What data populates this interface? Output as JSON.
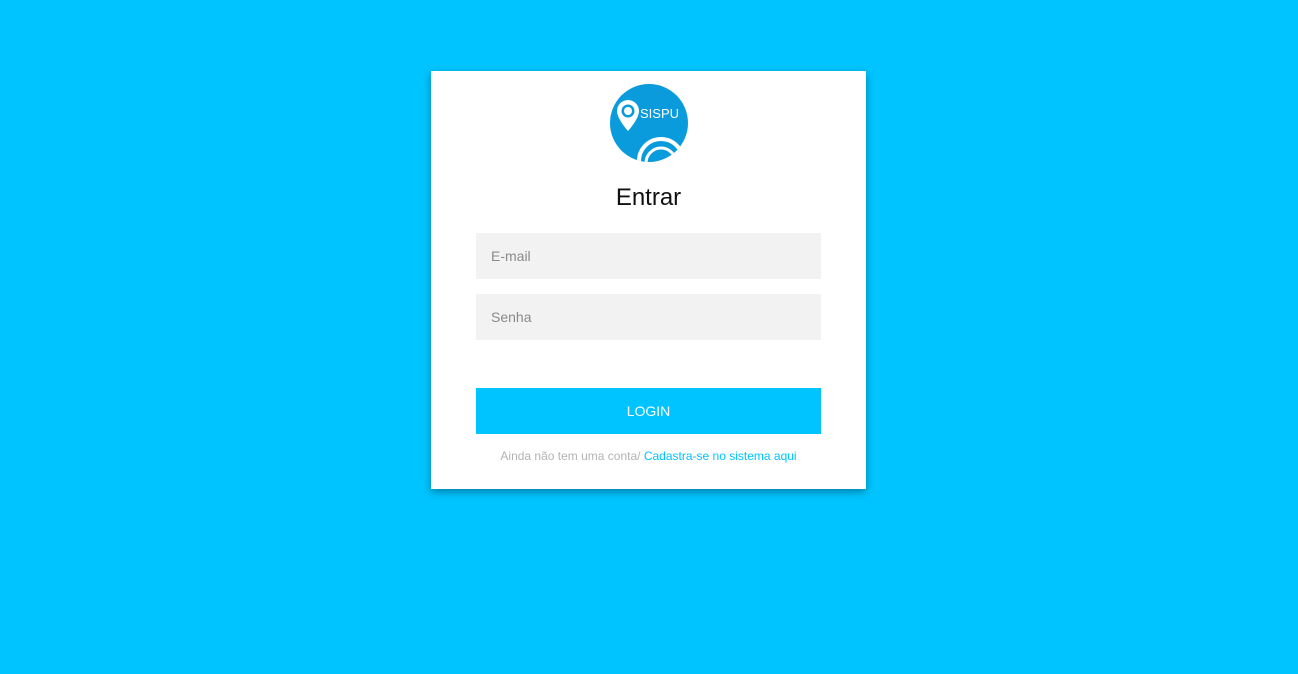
{
  "brand": {
    "logo_text": "SISPU",
    "logo_color": "#0a9bdc"
  },
  "page": {
    "background_color": "#00c4ff"
  },
  "login_form": {
    "title": "Entrar",
    "email_placeholder": "E-mail",
    "email_value": "",
    "password_placeholder": "Senha",
    "password_value": "",
    "submit_label": "LOGIN",
    "signup_prompt": "Ainda não tem uma conta/",
    "signup_link": "Cadastra-se no sistema aqui",
    "accent_color": "#00c4ff"
  }
}
